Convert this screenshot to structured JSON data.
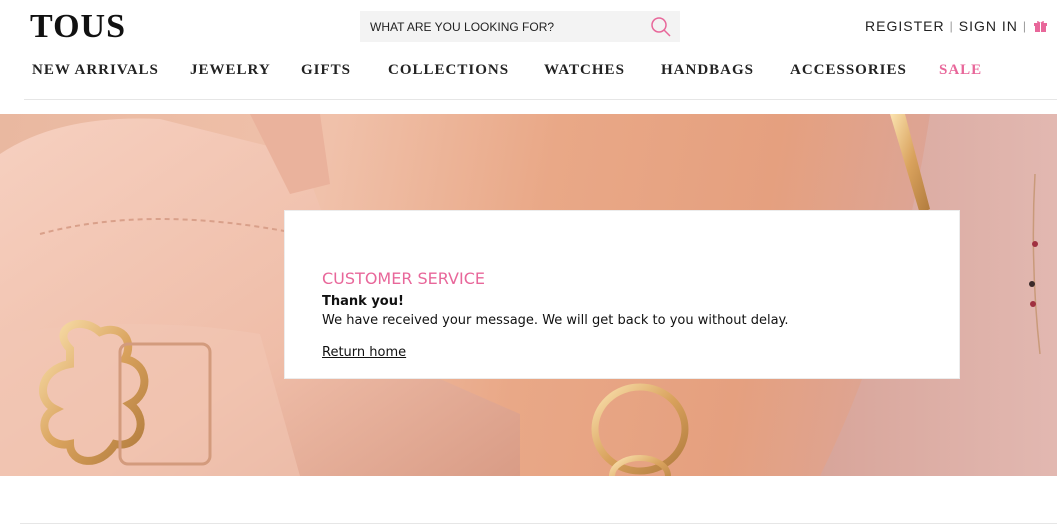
{
  "header": {
    "logo": "TOUS",
    "search_placeholder": "WHAT ARE YOU LOOKING FOR?",
    "register_label": "REGISTER",
    "separator": "|",
    "signin_label": "SIGN IN"
  },
  "nav": {
    "items": [
      {
        "label": "NEW ARRIVALS"
      },
      {
        "label": "JEWELRY"
      },
      {
        "label": "GIFTS"
      },
      {
        "label": "COLLECTIONS"
      },
      {
        "label": "WATCHES"
      },
      {
        "label": "HANDBAGS"
      },
      {
        "label": "ACCESSORIES"
      },
      {
        "label": "SALE"
      }
    ]
  },
  "message": {
    "title": "CUSTOMER SERVICE",
    "heading": "Thank you!",
    "text": "We have received your message. We will get back to you without delay.",
    "link": "Return home"
  },
  "colors": {
    "accent": "#e8679a",
    "text": "#222222"
  },
  "icons": {
    "search": "search-icon",
    "gift": "gift-icon"
  }
}
